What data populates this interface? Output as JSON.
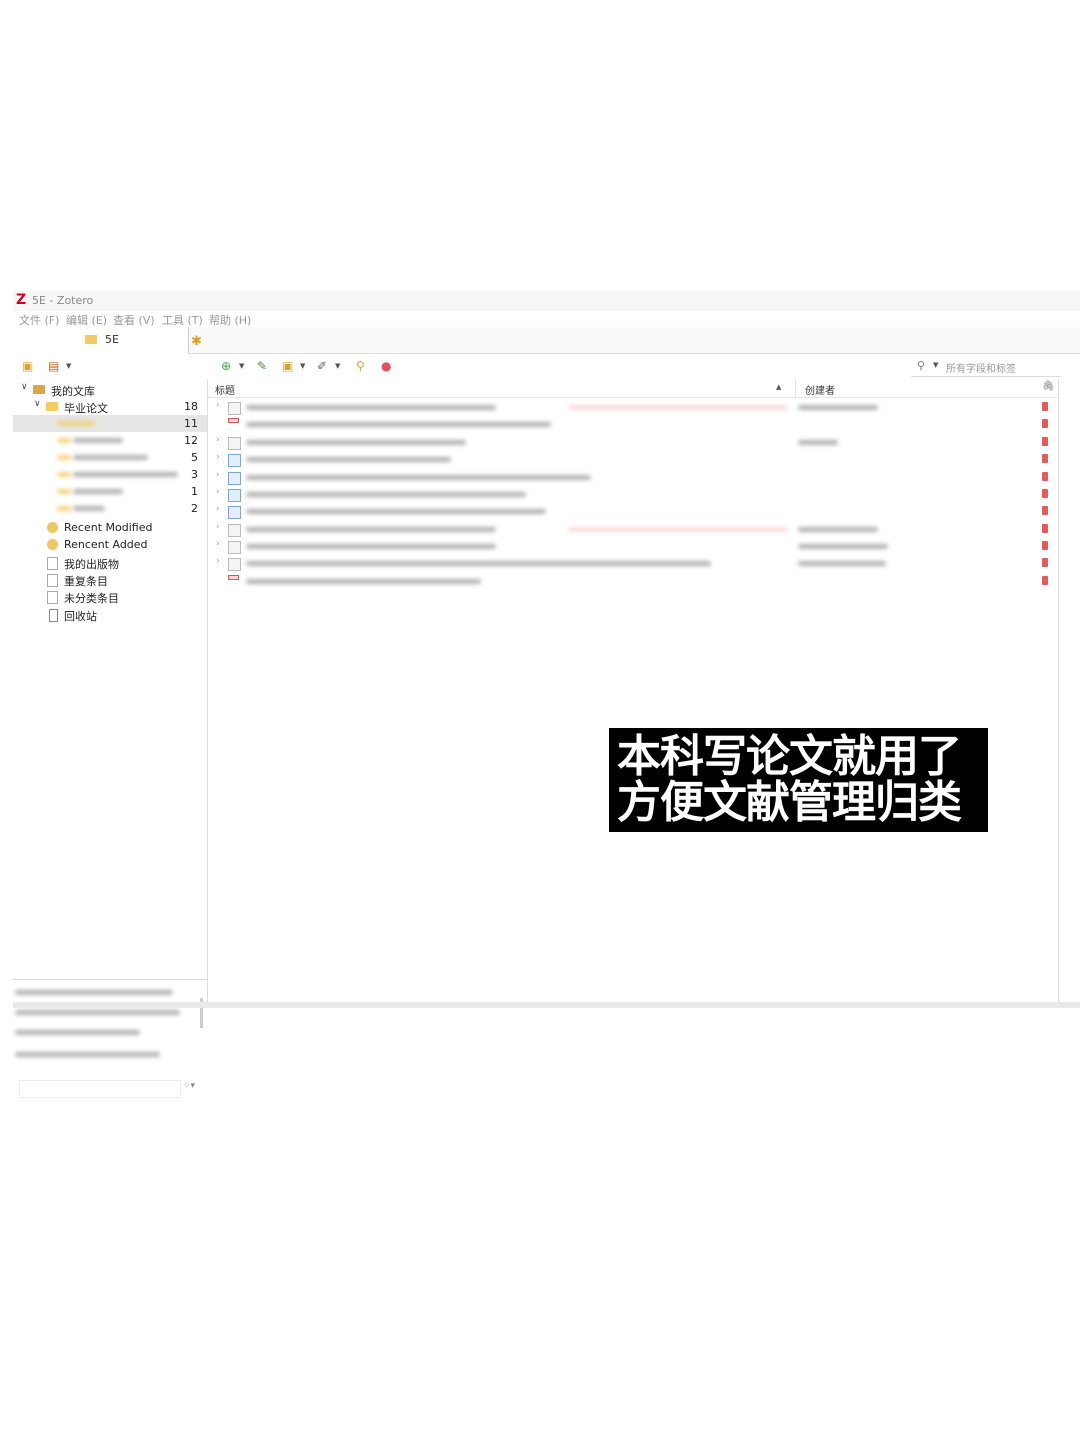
{
  "window": {
    "title": "5E - Zotero"
  },
  "menu": [
    "文件 (F)",
    "编辑 (E)",
    "查看 (V)",
    "工具 (T)",
    "帮助 (H)"
  ],
  "tab": {
    "label": "5E"
  },
  "search": {
    "placeholder": "所有字段和标签"
  },
  "tree": {
    "my_library": "我的文库",
    "thesis": {
      "label": "毕业论文",
      "count": "18"
    },
    "sub_counts": [
      "11",
      "12",
      "5",
      "3",
      "1",
      "2"
    ],
    "recent_modified": "Recent Modified",
    "recent_added": "Rencent Added",
    "my_publications": "我的出版物",
    "duplicates": "重复条目",
    "unfiled": "未分类条目",
    "trash": "回收站"
  },
  "columns": {
    "title": "标题",
    "creator": "创建者"
  },
  "caption": {
    "line1": "本科写论文就用了",
    "line2": "方便文献管理归类"
  }
}
